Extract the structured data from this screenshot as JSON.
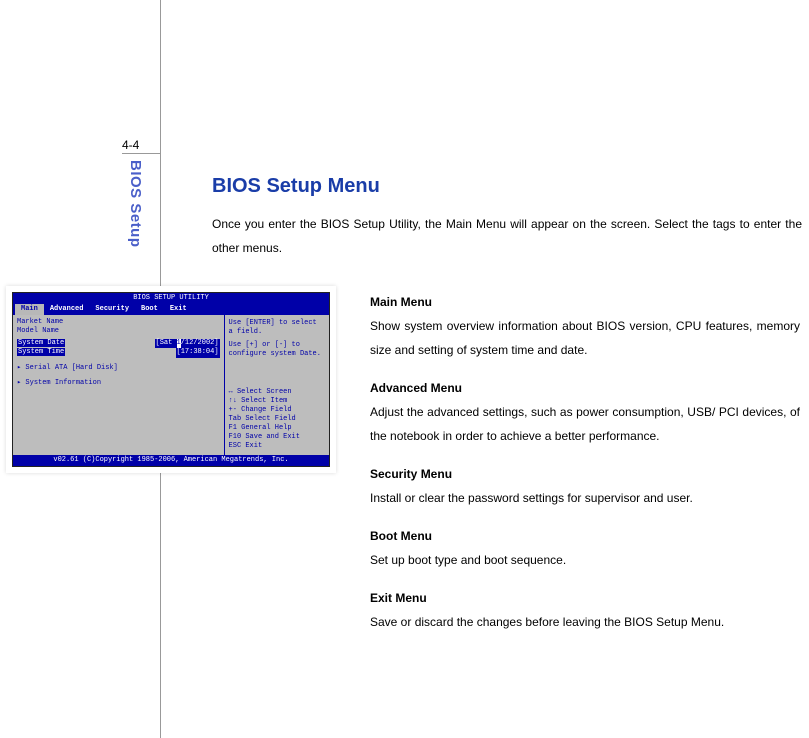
{
  "page_number": "4-4",
  "side_tab": "BIOS Setup",
  "heading": "BIOS Setup Menu",
  "intro": "Once you enter the BIOS Setup Utility, the Main Menu will appear on the screen.    Select the tags to enter the other menus.",
  "sections": [
    {
      "title": "Main Menu",
      "text": "Show system overview information about BIOS version, CPU features, memory size and setting of system time and date."
    },
    {
      "title": "Advanced Menu",
      "text": "Adjust the advanced settings, such as power consumption, USB/ PCI devices, of the notebook in order to achieve a better performance."
    },
    {
      "title": "Security Menu",
      "text": "Install or clear the password settings for supervisor and user."
    },
    {
      "title": "Boot Menu",
      "text": "Set up boot type and boot sequence."
    },
    {
      "title": "Exit Menu",
      "text": "Save or discard the changes before leaving the BIOS Setup Menu."
    }
  ],
  "bios": {
    "title": "BIOS SETUP UTILITY",
    "tabs": [
      "Main",
      "Advanced",
      "Security",
      "Boot",
      "Exit"
    ],
    "left": {
      "l1": "Market Name",
      "l2": "Model Name",
      "l3a": "System Date",
      "l3b": "[Sat ",
      "l3c": "1",
      "l3d": "/12/2002]",
      "l4a": "System Time",
      "l4b": "[17:38:04]",
      "l5": "▸ Serial ATA          [Hard Disk]",
      "l6": "▸ System Information"
    },
    "right_top": {
      "r1": "Use [ENTER] to select",
      "r2": "a field.",
      "r3": "Use [+] or [-] to",
      "r4": "configure system Date."
    },
    "right_bottom": {
      "b1": "↔   Select Screen",
      "b2": "↑↓  Select Item",
      "b3": "+-  Change Field",
      "b4": "Tab Select Field",
      "b5": "F1  General Help",
      "b6": "F10 Save and Exit",
      "b7": "ESC Exit"
    },
    "footer": "v02.61 (C)Copyright 1985-2006, American Megatrends, Inc."
  }
}
